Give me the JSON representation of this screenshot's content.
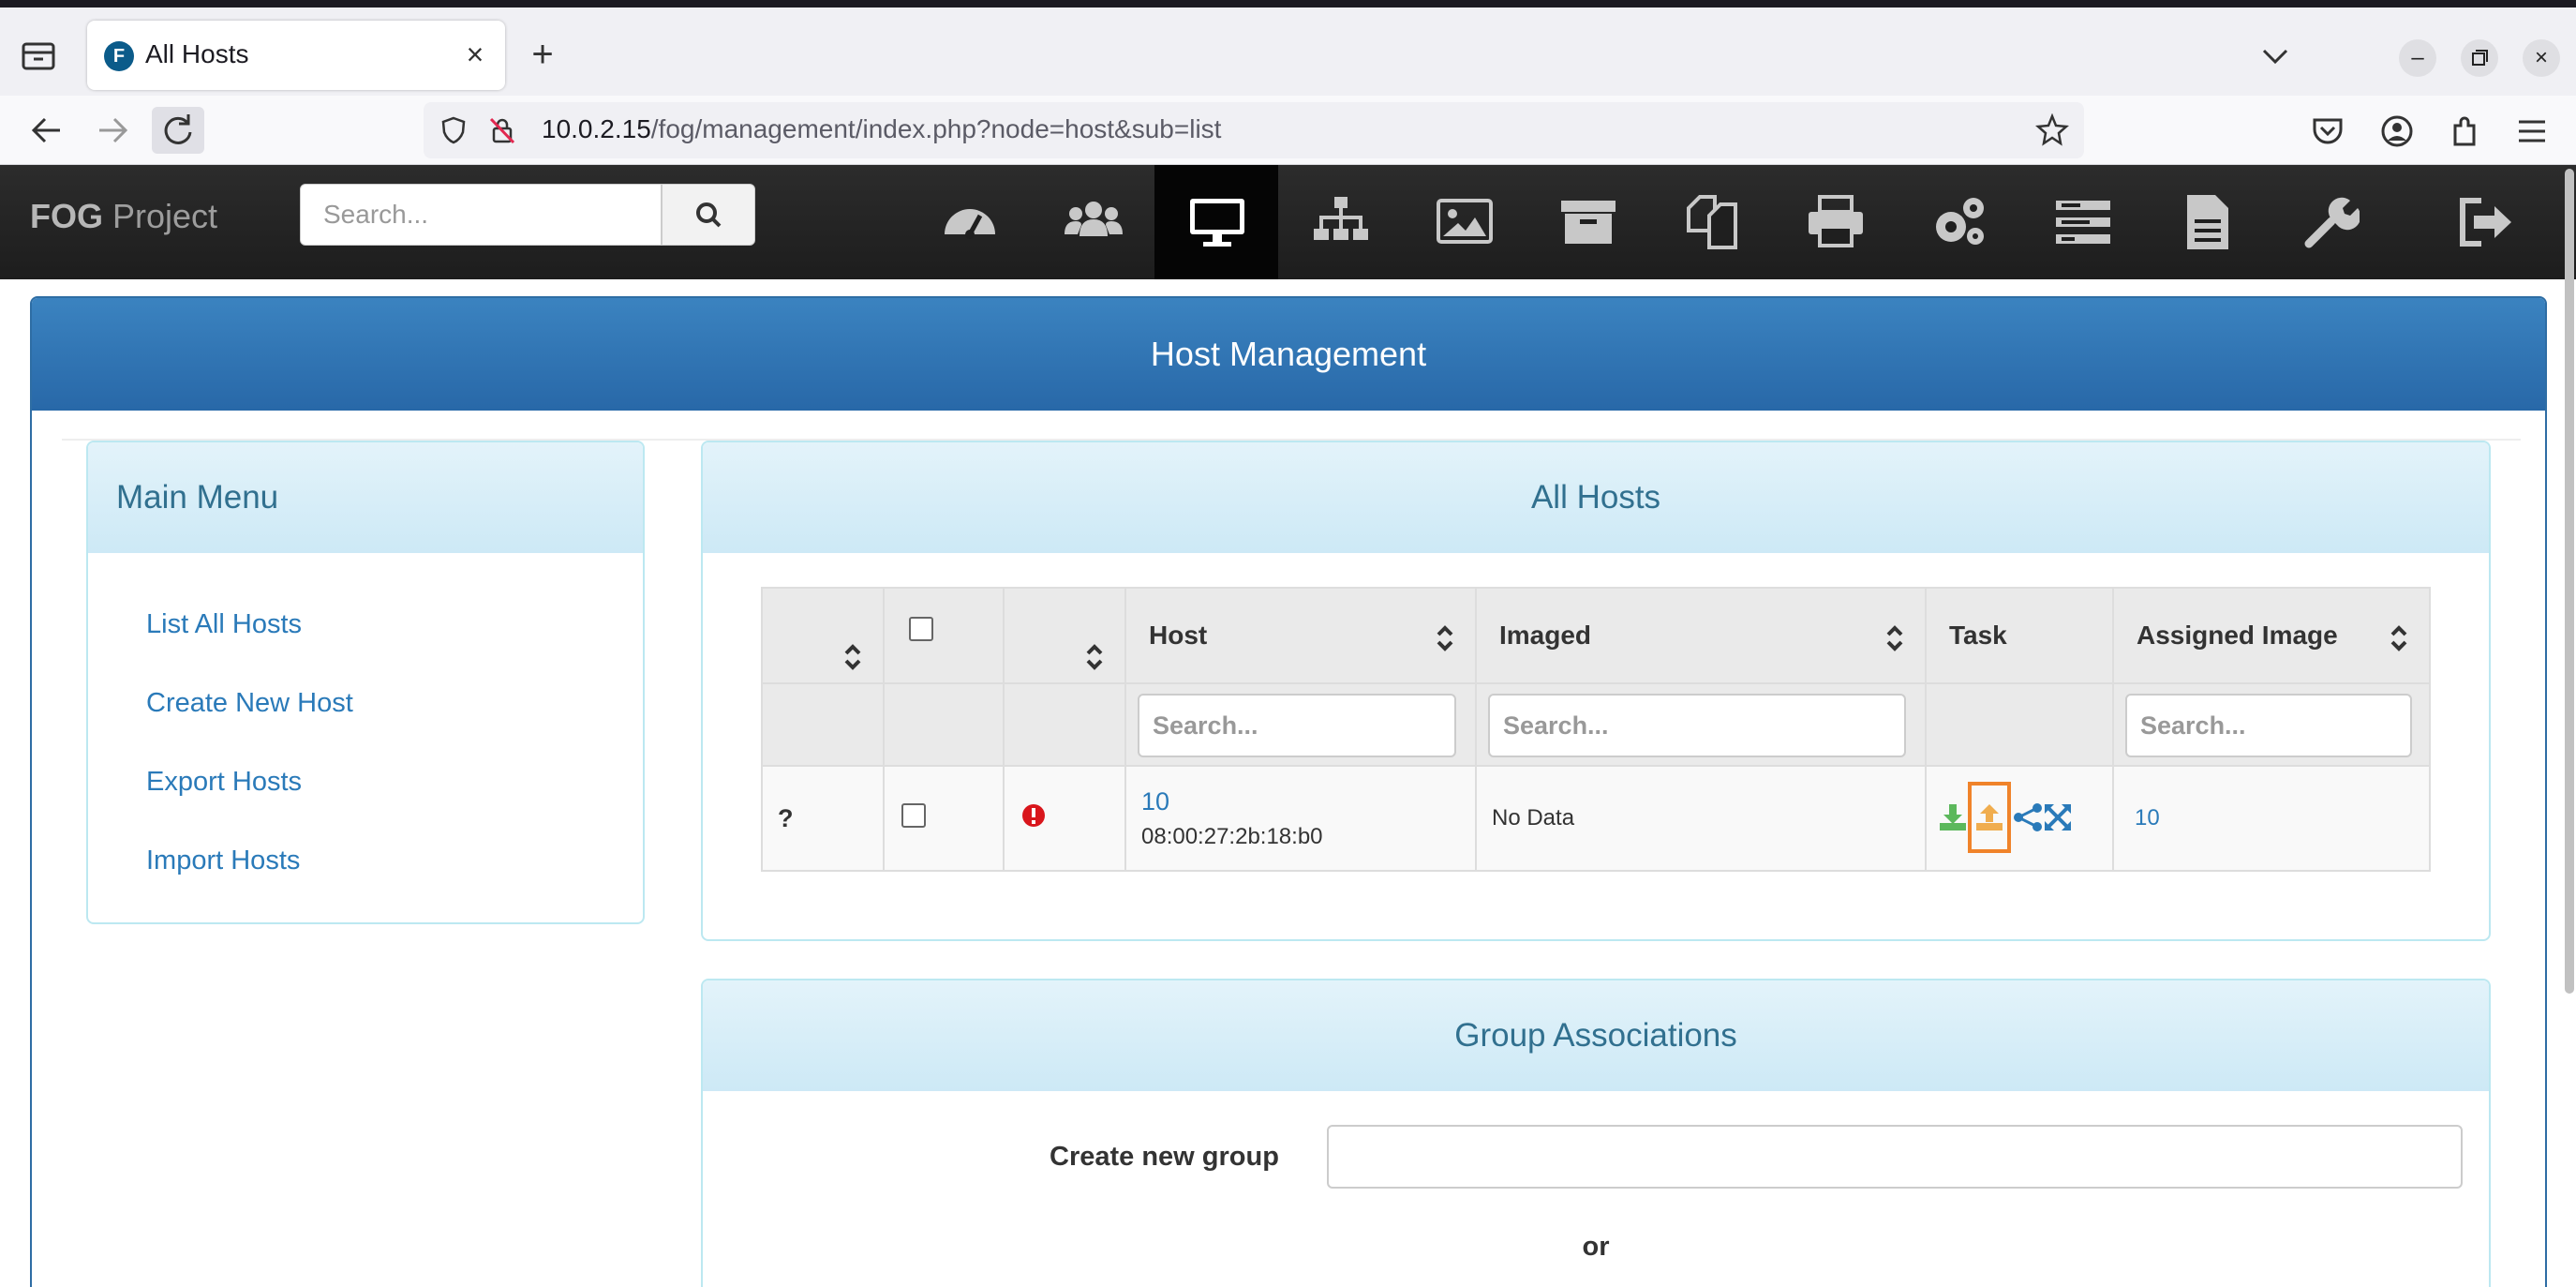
{
  "browser": {
    "tab_title": "All Hosts",
    "favicon_letter": "F",
    "url_host": "10.0.2.15",
    "url_path": "/fog/management/index.php?node=host&sub=list"
  },
  "header": {
    "logo_bold": "FOG",
    "logo_rest": " Project",
    "search_placeholder": "Search...",
    "nav_icons": [
      "dashboard-icon",
      "users-icon",
      "hosts-icon",
      "groups-icon",
      "images-icon",
      "storage-icon",
      "snapins-icon",
      "printers-icon",
      "configuration-icon",
      "tasks-icon",
      "reports-icon",
      "settings-icon",
      "logout-icon"
    ]
  },
  "page": {
    "title": "Host Management"
  },
  "main_menu": {
    "title": "Main Menu",
    "items": [
      "List All Hosts",
      "Create New Host",
      "Export Hosts",
      "Import Hosts"
    ]
  },
  "all_hosts": {
    "title": "All Hosts",
    "columns": [
      "",
      "",
      "",
      "Host",
      "Imaged",
      "Task",
      "Assigned Image"
    ],
    "search_placeholder": "Search...",
    "rows": [
      {
        "ping": "?",
        "host_name": "10",
        "mac": "08:00:27:2b:18:b0",
        "imaged": "No Data",
        "task_icons": [
          "deploy-icon",
          "capture-icon",
          "multicast-icon",
          "advanced-icon"
        ],
        "assigned_image": "10"
      }
    ]
  },
  "groups": {
    "title": "Group Associations",
    "create_label": "Create new group",
    "or_text": "or"
  },
  "colors": {
    "primary": "#2e6da4",
    "panel_heading": "#31708f",
    "link": "#2a7ab9",
    "highlight": "#f0832a",
    "deploy": "#5cb85c",
    "capture": "#f0ad4e"
  }
}
